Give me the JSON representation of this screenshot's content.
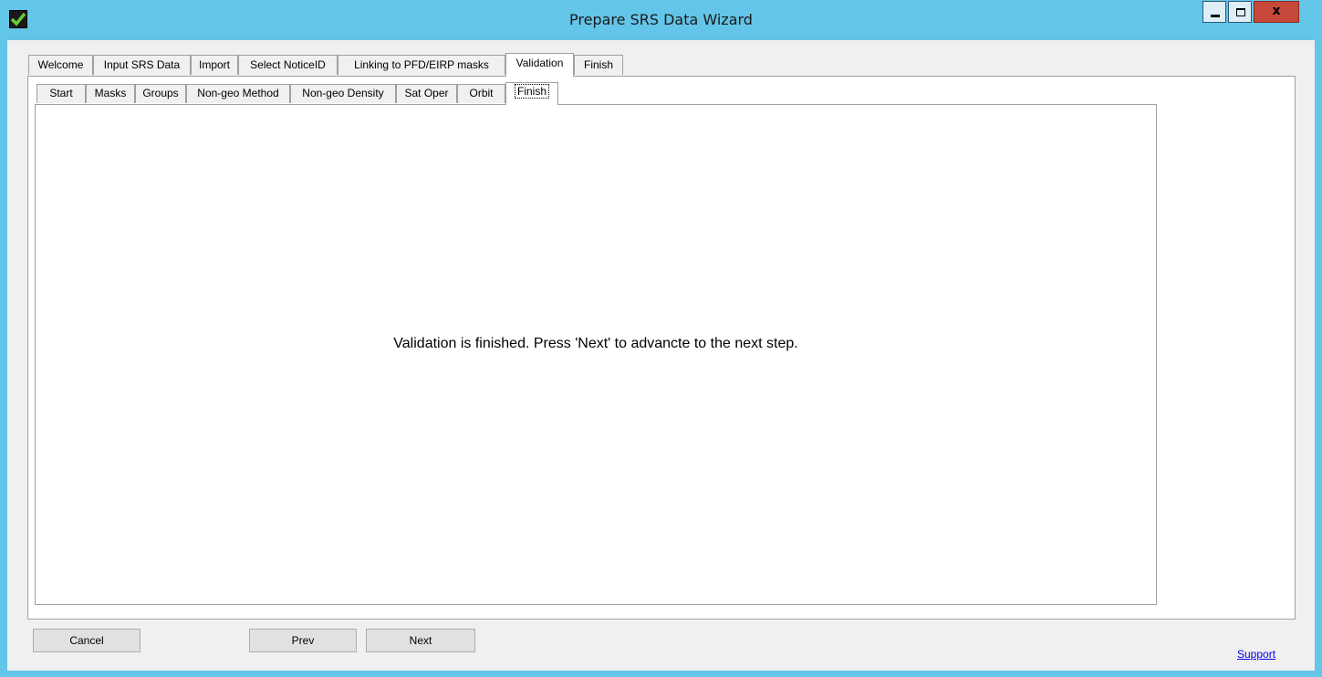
{
  "window": {
    "title": "Prepare SRS Data Wizard",
    "icon": "green-check-icon"
  },
  "titlebar_buttons": {
    "minimize": "minimize-icon",
    "maximize": "maximize-icon",
    "close": "x"
  },
  "outer_tabs": [
    {
      "label": "Welcome"
    },
    {
      "label": "Input SRS Data"
    },
    {
      "label": "Import"
    },
    {
      "label": "Select NoticeID"
    },
    {
      "label": "Linking to PFD/EIRP masks"
    },
    {
      "label": "Validation",
      "selected": true
    },
    {
      "label": "Finish"
    }
  ],
  "inner_tabs": [
    {
      "label": "Start"
    },
    {
      "label": "Masks"
    },
    {
      "label": "Groups"
    },
    {
      "label": "Non-geo Method"
    },
    {
      "label": "Non-geo Density"
    },
    {
      "label": "Sat Oper"
    },
    {
      "label": "Orbit"
    },
    {
      "label": "Finish",
      "selected": true
    }
  ],
  "panel": {
    "message": "Validation is finished. Press 'Next' to advancte to the next step."
  },
  "footer": {
    "cancel_label": "Cancel",
    "prev_label": "Prev",
    "next_label": "Next",
    "support_label": "Support"
  },
  "colors": {
    "title_bar": "#63c5e8",
    "close_button": "#c7493c",
    "check_icon": "#66cc33"
  }
}
